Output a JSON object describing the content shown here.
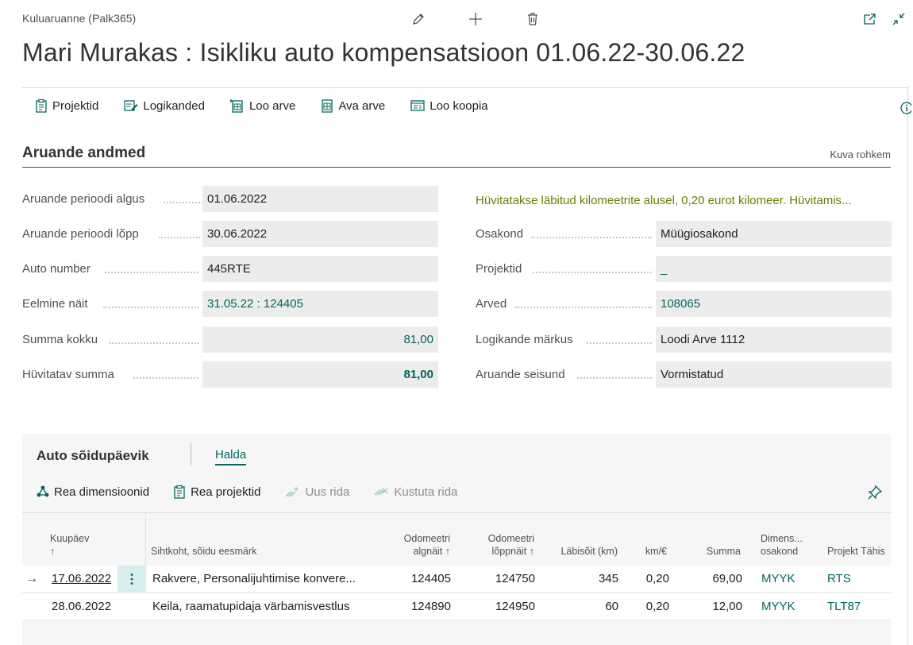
{
  "header": {
    "breadcrumb": "Kuluaruanne (Palk365)",
    "title": "Mari Murakas : Isikliku auto kompensatsioon 01.06.22-30.06.22"
  },
  "actions": [
    {
      "label": "Projektid",
      "icon": "clipboard-icon"
    },
    {
      "label": "Logikanded",
      "icon": "log-entries-icon"
    },
    {
      "label": "Loo arve",
      "icon": "create-invoice-icon"
    },
    {
      "label": "Ava arve",
      "icon": "open-invoice-icon"
    },
    {
      "label": "Loo koopia",
      "icon": "copy-document-icon"
    }
  ],
  "section": {
    "title": "Aruande andmed",
    "show_more": "Kuva rohkem",
    "note": "Hüvitatakse läbitud kilomeetrite alusel, 0,20 eurot kilomeer. Hüvitamis...",
    "left_fields": [
      {
        "label": "Aruande perioodi algus",
        "value": "01.06.2022"
      },
      {
        "label": "Aruande perioodi lõpp",
        "value": "30.06.2022"
      },
      {
        "label": "Auto number",
        "value": "445RTE"
      },
      {
        "label": "Eelmine näit",
        "value": "31.05.22 : 124405"
      },
      {
        "label": "Summa kokku",
        "value": "81,00"
      },
      {
        "label": "Hüvitatav summa",
        "value": "81,00"
      }
    ],
    "right_fields": [
      {
        "label": "Osakond",
        "value": "Müügiosakond"
      },
      {
        "label": "Projektid",
        "value": "_"
      },
      {
        "label": "Arved",
        "value": "108065"
      },
      {
        "label": "Logikande märkus",
        "value": "Loodi Arve 1112"
      },
      {
        "label": "Aruande seisund",
        "value": "Vormistatud"
      }
    ]
  },
  "subpage": {
    "title": "Auto sõidupäevik",
    "tab": "Halda",
    "actions": [
      {
        "label": "Rea dimensioonid",
        "enabled": true
      },
      {
        "label": "Rea projektid",
        "enabled": true
      },
      {
        "label": "Uus rida",
        "enabled": false
      },
      {
        "label": "Kustuta rida",
        "enabled": false
      }
    ],
    "columns": {
      "date": "Kuupäev",
      "date_sort": "↑",
      "destination": "Sihtkoht, sõidu eesmärk",
      "odo_start_1": "Odomeetri",
      "odo_start_2": "algnäit ↑",
      "odo_end_1": "Odomeetri",
      "odo_end_2": "lõppnäit ↑",
      "distance": "Läbisõit (km)",
      "rate": "km/€",
      "amount": "Summa",
      "dim_1": "Dimens...",
      "dim_2": "osakond",
      "project": "Projekt Tähis"
    },
    "rows": [
      {
        "date": "17.06.2022",
        "destination": "Rakvere, Personalijuhtimise konvere...",
        "odo_start": "124405",
        "odo_end": "124750",
        "distance": "345",
        "rate": "0,20",
        "amount": "69,00",
        "dimension": "MYYK",
        "project": "RTS"
      },
      {
        "date": "28.06.2022",
        "destination": "Keila, raamatupidaja värbamisvestlus",
        "odo_start": "124890",
        "odo_end": "124950",
        "distance": "60",
        "rate": "0,20",
        "amount": "12,00",
        "dimension": "MYYK",
        "project": "TLT87"
      }
    ]
  },
  "colors": {
    "accent": "#00665e",
    "note": "#6e7a00",
    "field_bg": "#ececec",
    "selected_cell": "#d8eeec"
  }
}
